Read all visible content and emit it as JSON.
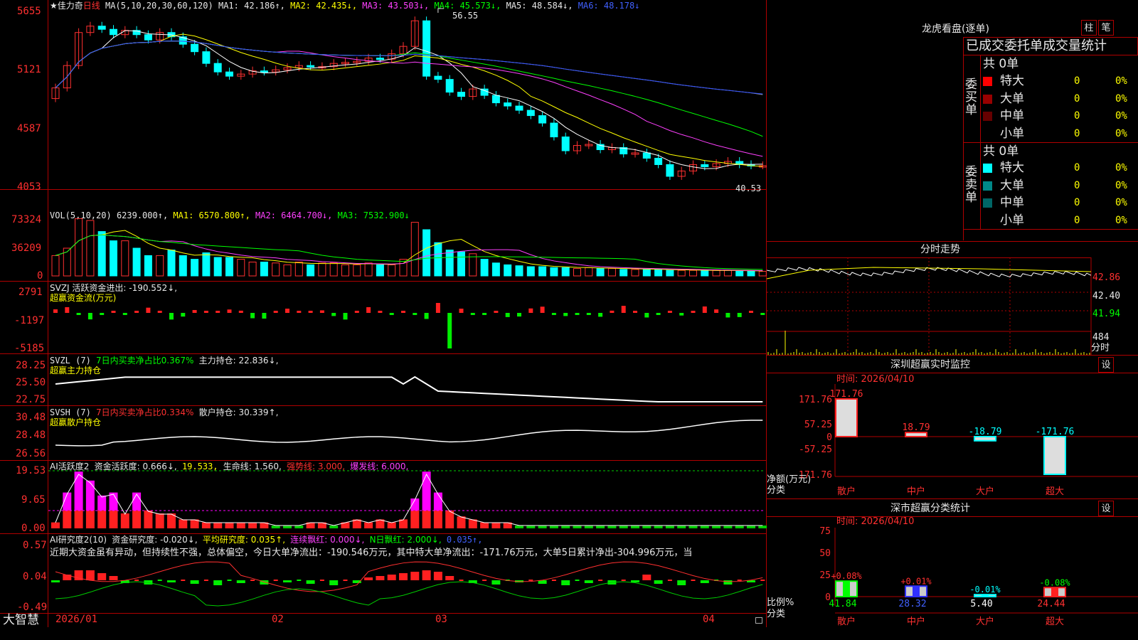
{
  "stock": {
    "name": "★佳力奇",
    "period": "日线",
    "ma_label": "MA(5,10,20,30,60,120)",
    "ma1": "MA1: 42.186↑,",
    "ma2": "MA2: 42.435↓,",
    "ma3": "MA3: 43.503↓,",
    "ma4": "MA4: 45.573↓,",
    "ma5": "MA5: 48.584↓,",
    "ma6": "MA6: 48.178↓",
    "high_mark": "56.55",
    "low_mark": "40.53",
    "price_ticks": [
      "5655",
      "5121",
      "4587",
      "4053"
    ]
  },
  "volume": {
    "label": "VOL(5,10,20)",
    "value": "6239.000↑,",
    "ma1": "MA1: 6570.800↑,",
    "ma2": "MA2: 6464.700↓,",
    "ma3": "MA3: 7532.900↓",
    "ticks": [
      "73324",
      "36209",
      "0"
    ]
  },
  "svzj": {
    "label": "SVZJ  活跃资金进出: -190.552↓,",
    "sub": "超赢资金流(万元)",
    "ticks": [
      "2791",
      "-1197",
      "-5185"
    ]
  },
  "svzl": {
    "label": "SVZL (7)",
    "ratio": "7日内买卖净占比0.367%",
    "hold": "主力持仓: 22.836↓,",
    "sub": "超赢主力持仓",
    "ticks": [
      "28.25",
      "25.50",
      "22.75"
    ]
  },
  "svsh": {
    "label": "SVSH (7)",
    "ratio": "7日内买卖净占比0.334%",
    "hold": "散户持仓: 30.339↑,",
    "sub": "超赢散户持仓",
    "ticks": [
      "30.48",
      "28.48",
      "26.56"
    ]
  },
  "ai_active": {
    "label": "AI活跃度2",
    "v1": "资金活跃度: 0.666↓,",
    "v2": "19.533,",
    "v3": "生命线: 1.560,",
    "v4": "强势线: 3.000,",
    "v5": "爆发线: 6.000,",
    "ticks": [
      "19.53",
      "9.65",
      "0.00"
    ]
  },
  "ai_research": {
    "label": "AI研究度2(10)",
    "v1": "资金研究度: -0.020↓,",
    "v2": "平均研究度: 0.035↑,",
    "v3": "连续飘红: 0.000↓,",
    "v4": "N日飘红: 2.000↓,",
    "v5": "0.035↑,",
    "comment": "近期大资金虽有异动，但持续性不强，总体偏空，今日大单净流出：-190.546万元，其中特大单净流出：-171.76万元，大单5日累计净出-304.996万元，当",
    "ticks": [
      "0.57",
      "0.04",
      "-0.49"
    ]
  },
  "date_axis": [
    "2026/01",
    "02",
    "03",
    "04"
  ],
  "brand": "大智慧",
  "dragon": {
    "title": "龙虎看盘(逐单)",
    "tab1": "柱",
    "tab2": "笔",
    "subtitle": "已成交委托单成交量统计",
    "buy_total": "共 0单",
    "buy_label": "委买单",
    "sell_total": "共 0单",
    "sell_label": "委卖单",
    "buy_rows": [
      {
        "name": "特大",
        "count": "0",
        "pct": "0%",
        "color": "#ff0000"
      },
      {
        "name": "大单",
        "count": "0",
        "pct": "0%",
        "color": "#990000"
      },
      {
        "name": "中单",
        "count": "0",
        "pct": "0%",
        "color": "#660000"
      },
      {
        "name": "小单",
        "count": "0",
        "pct": "0%",
        "color": "#000000"
      }
    ],
    "sell_rows": [
      {
        "name": "特大",
        "count": "0",
        "pct": "0%",
        "color": "#00ffff"
      },
      {
        "name": "大单",
        "count": "0",
        "pct": "0%",
        "color": "#008888"
      },
      {
        "name": "中单",
        "count": "0",
        "pct": "0%",
        "color": "#006666"
      },
      {
        "name": "小单",
        "count": "0",
        "pct": "0%",
        "color": "#000000"
      }
    ]
  },
  "intraday": {
    "title": "分时走势",
    "ticks": [
      "42.86",
      "42.40",
      "41.94",
      "484"
    ],
    "unit": "分时"
  },
  "sz_monitor": {
    "title": "深圳超赢实时监控",
    "settings": "设",
    "time": "时间: 2026/04/10",
    "y_ticks": [
      "171.76",
      "57.25",
      "0",
      "-57.25",
      "-171.76"
    ],
    "ylabel": "净额(万元)",
    "xlabel": "分类",
    "categories": [
      "散户",
      "中户",
      "大户",
      "超大"
    ],
    "value_labels": [
      "171.76",
      "18.79",
      "-18.79",
      "-171.76"
    ]
  },
  "sz_classify": {
    "title": "深市超赢分类统计",
    "settings": "设",
    "time": "时间: 2026/04/10",
    "y_ticks": [
      "75",
      "50",
      "25",
      "0"
    ],
    "ylabel": "比例%",
    "xlabel": "分类",
    "categories": [
      "散户",
      "中户",
      "大户",
      "超大"
    ],
    "pct_labels": [
      "+0.08%",
      "+0.01%",
      "-0.01%",
      "-0.08%"
    ],
    "bottom_values": [
      "41.84",
      "28.32",
      "5.40",
      "24.44"
    ]
  },
  "chart_data": [
    {
      "type": "bar",
      "title": "深圳超赢实时监控",
      "categories": [
        "散户",
        "中户",
        "大户",
        "超大"
      ],
      "values": [
        171.76,
        18.79,
        -18.79,
        -171.76
      ],
      "ylabel": "净额(万元)",
      "ylim": [
        -171.76,
        171.76
      ]
    },
    {
      "type": "bar",
      "title": "深市超赢分类统计",
      "categories": [
        "散户",
        "中户",
        "大户",
        "超大"
      ],
      "values": [
        41.84,
        28.32,
        5.4,
        24.44
      ],
      "ylabel": "比例%",
      "ylim": [
        0,
        75
      ]
    }
  ]
}
